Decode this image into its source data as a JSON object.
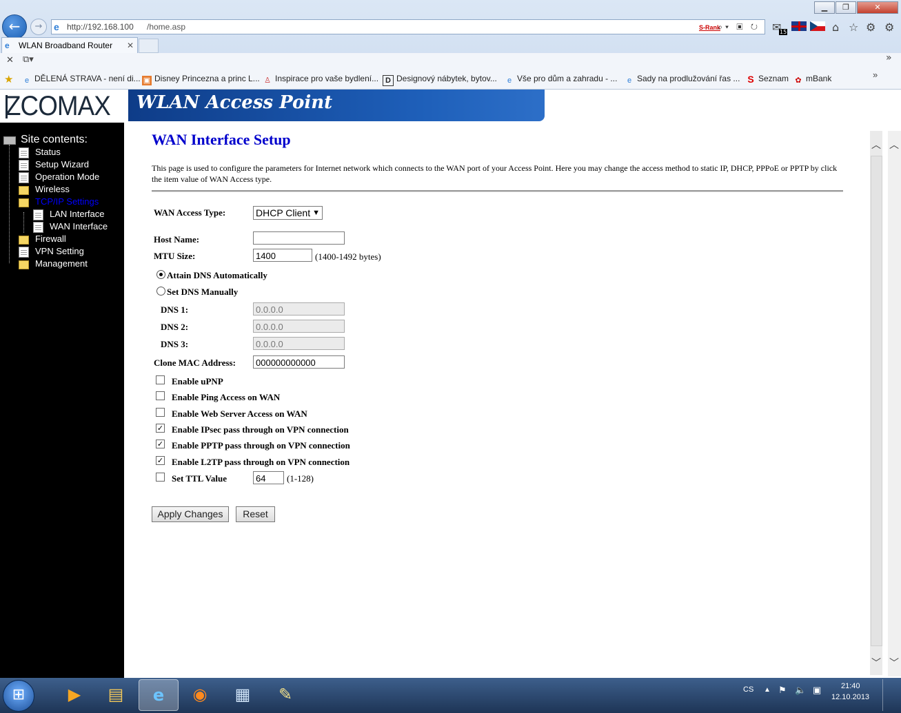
{
  "browser": {
    "url_host": "http://192.168.100",
    "url_path": "/home.asp",
    "tab_title": "WLAN Broadband Router",
    "srank": "S-Rank",
    "favorites": [
      {
        "label": "DĚLENÁ STRAVA - není di..."
      },
      {
        "label": "Disney Princezna a princ L..."
      },
      {
        "label": "Inspirace pro vaše bydlení..."
      },
      {
        "label": "Designový nábytek, bytov..."
      },
      {
        "label": "Vše pro dům a zahradu - ..."
      },
      {
        "label": "Sady na prodlužování řas ..."
      },
      {
        "label": "Seznam"
      },
      {
        "label": "mBank"
      }
    ],
    "mail_badge": "15"
  },
  "header": {
    "logo": "ZCOMAX",
    "banner": "WLAN Access Point"
  },
  "sidebar": {
    "title": "Site contents:",
    "items": [
      {
        "label": "Status"
      },
      {
        "label": "Setup Wizard"
      },
      {
        "label": "Operation Mode"
      },
      {
        "label": "Wireless"
      },
      {
        "label": "TCP/IP Settings"
      },
      {
        "label": "LAN Interface"
      },
      {
        "label": "WAN Interface"
      },
      {
        "label": "Firewall"
      },
      {
        "label": "VPN Setting"
      },
      {
        "label": "Management"
      }
    ]
  },
  "main": {
    "title": "WAN Interface Setup",
    "description": "This page is used to configure the parameters for Internet network which connects to the WAN port of your Access Point. Here you may change the access method to static IP, DHCP, PPPoE or PPTP by click the item value of WAN Access type.",
    "wan_access_type_label": "WAN Access Type:",
    "wan_access_type_value": "DHCP Client",
    "host_name_label": "Host Name:",
    "host_name_value": "",
    "mtu_label": "MTU Size:",
    "mtu_value": "1400",
    "mtu_note": "(1400-1492 bytes)",
    "dns_auto_label": "Attain DNS Automatically",
    "dns_manual_label": "Set DNS Manually",
    "dns1_label": "DNS 1:",
    "dns1_value": "0.0.0.0",
    "dns2_label": "DNS 2:",
    "dns2_value": "0.0.0.0",
    "dns3_label": "DNS 3:",
    "dns3_value": "0.0.0.0",
    "clone_mac_label": "Clone MAC Address:",
    "clone_mac_value": "000000000000",
    "checkboxes": [
      {
        "label": "Enable uPNP",
        "checked": false
      },
      {
        "label": "Enable Ping Access on WAN",
        "checked": false
      },
      {
        "label": "Enable Web Server Access on WAN",
        "checked": false
      },
      {
        "label": "Enable IPsec pass through on VPN connection",
        "checked": true
      },
      {
        "label": "Enable PPTP pass through on VPN connection",
        "checked": true
      },
      {
        "label": "Enable L2TP pass through on VPN connection",
        "checked": true
      },
      {
        "label": "Set TTL Value",
        "checked": false
      }
    ],
    "ttl_value": "64",
    "ttl_note": "(1-128)",
    "apply_label": "Apply Changes",
    "reset_label": "Reset"
  },
  "taskbar": {
    "lang": "CS",
    "time": "21:40",
    "date": "12.10.2013"
  },
  "colors": {
    "title_blue": "#0000cc",
    "banner_blue": "#1e5fb9",
    "sidebar_bg": "#000000",
    "active_menu": "#0000ff"
  }
}
